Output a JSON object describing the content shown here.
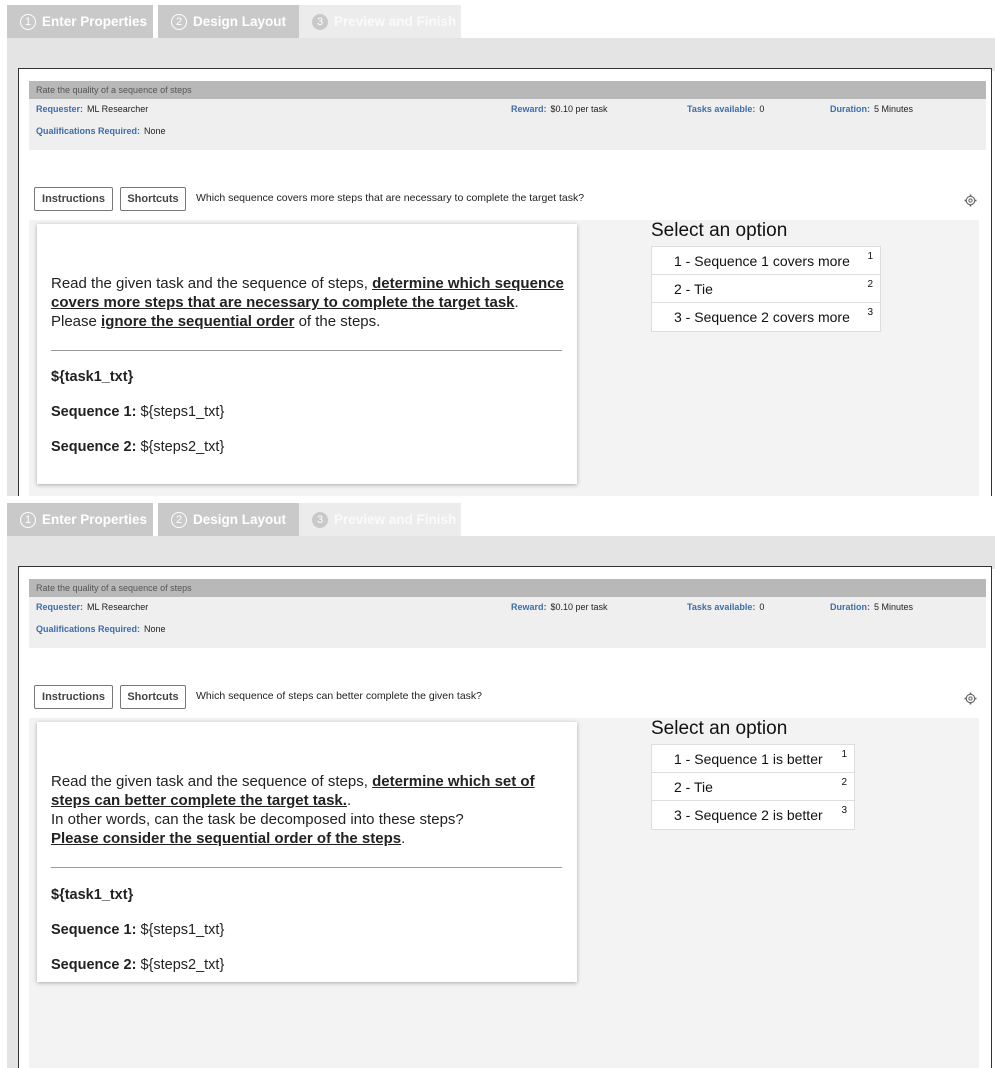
{
  "tabs": [
    {
      "num": "1",
      "label": "Enter Properties"
    },
    {
      "num": "2",
      "label": "Design Layout"
    },
    {
      "num": "3",
      "label": "Preview and Finish"
    }
  ],
  "panels": [
    {
      "hit_title": "Rate the quality of a sequence of steps",
      "meta": {
        "requester_label": "Requester:",
        "requester": "ML Researcher",
        "reward_label": "Reward:",
        "reward": "$0.10 per task",
        "tasks_label": "Tasks available:",
        "tasks": "0",
        "duration_label": "Duration:",
        "duration": "5 Minutes",
        "quals_label": "Qualifications Required:",
        "quals": "None"
      },
      "toolbar": {
        "instructions": "Instructions",
        "shortcuts": "Shortcuts",
        "question": "Which sequence covers more steps that are necessary to complete the target task?"
      },
      "card": {
        "line1_a": "Read the given task and the sequence of steps, ",
        "line1_b": "determine which sequence covers more steps that are necessary to complete the target task",
        "line1_c": ".",
        "line2_a": "Please ",
        "line2_b": "ignore the sequential order",
        "line2_c": " of the steps.",
        "line3": "",
        "line3_b": "",
        "line3_c": "",
        "task": "${task1_txt}",
        "seq1_label": "Sequence 1:",
        "seq1": " ${steps1_txt}",
        "seq2_label": "Sequence 2:",
        "seq2": " ${steps2_txt}"
      },
      "options_title": "Select an option",
      "options": [
        {
          "label": "1 - Sequence 1 covers more",
          "key": "1"
        },
        {
          "label": "2 - Tie",
          "key": "2"
        },
        {
          "label": "3 - Sequence 2 covers more",
          "key": "3"
        }
      ]
    },
    {
      "hit_title": "Rate the quality of a sequence of steps",
      "meta": {
        "requester_label": "Requester:",
        "requester": "ML Researcher",
        "reward_label": "Reward:",
        "reward": "$0.10 per task",
        "tasks_label": "Tasks available:",
        "tasks": "0",
        "duration_label": "Duration:",
        "duration": "5 Minutes",
        "quals_label": "Qualifications Required:",
        "quals": "None"
      },
      "toolbar": {
        "instructions": "Instructions",
        "shortcuts": "Shortcuts",
        "question": "Which sequence of steps can better complete the given task?"
      },
      "card": {
        "line1_a": "Read the given task and the sequence of steps, ",
        "line1_b": "determine which set of steps can better complete the target task.",
        "line1_c": ".",
        "line2_a": "In other words, can the task be decomposed into these steps?",
        "line2_b": "",
        "line2_c": "",
        "line3": "",
        "line3_b": "Please consider the sequential order of the steps",
        "line3_c": ".",
        "task": "${task1_txt}",
        "seq1_label": "Sequence 1:",
        "seq1": " ${steps1_txt}",
        "seq2_label": "Sequence 2:",
        "seq2": " ${steps2_txt}"
      },
      "options_title": "Select an option",
      "options": [
        {
          "label": "1 - Sequence 1 is better",
          "key": "1"
        },
        {
          "label": "2 - Tie",
          "key": "2"
        },
        {
          "label": "3 - Sequence 2 is better",
          "key": "3"
        }
      ]
    }
  ]
}
